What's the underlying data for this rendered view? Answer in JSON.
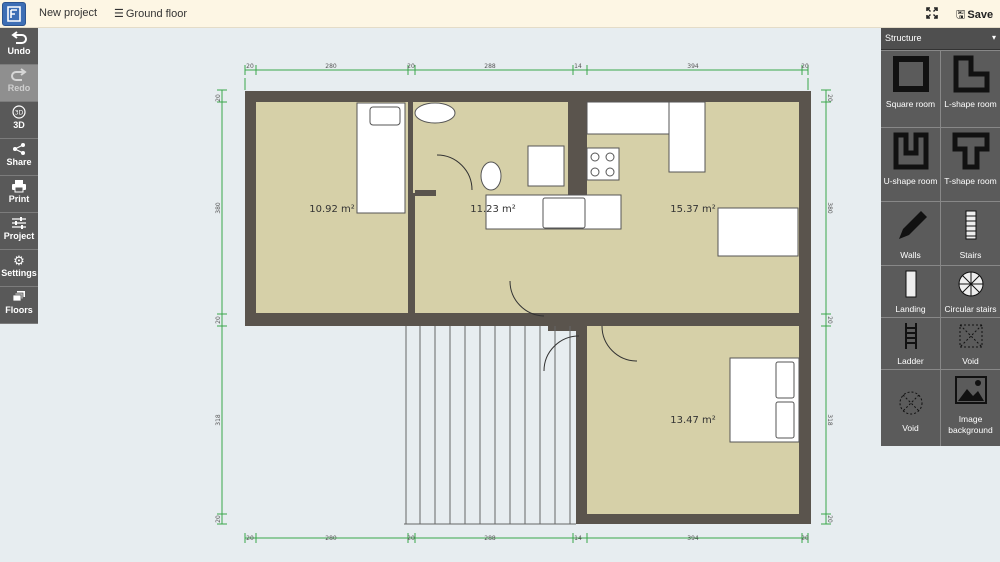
{
  "topbar": {
    "project_name": "New project",
    "floor_label": "Ground floor",
    "save_label": "Save"
  },
  "left_toolbar": [
    {
      "id": "undo",
      "label": "Undo",
      "icon": "undo-icon",
      "enabled": true
    },
    {
      "id": "redo",
      "label": "Redo",
      "icon": "redo-icon",
      "enabled": false
    },
    {
      "id": "3d",
      "label": "3D",
      "icon": "3d-icon",
      "enabled": true
    },
    {
      "id": "share",
      "label": "Share",
      "icon": "share-icon",
      "enabled": true
    },
    {
      "id": "print",
      "label": "Print",
      "icon": "print-icon",
      "enabled": true
    },
    {
      "id": "project",
      "label": "Project",
      "icon": "sliders-icon",
      "enabled": true
    },
    {
      "id": "settings",
      "label": "Settings",
      "icon": "gear-icon",
      "enabled": true
    },
    {
      "id": "floors",
      "label": "Floors",
      "icon": "floors-icon",
      "enabled": true
    }
  ],
  "right_panel": {
    "category": "Structure",
    "items": [
      {
        "label": "Square room",
        "icon": "square-room-icon"
      },
      {
        "label": "L-shape room",
        "icon": "l-shape-room-icon"
      },
      {
        "label": "U-shape room",
        "icon": "u-shape-room-icon"
      },
      {
        "label": "T-shape room",
        "icon": "t-shape-room-icon"
      },
      {
        "label": "Walls",
        "icon": "pencil-icon"
      },
      {
        "label": "Stairs",
        "icon": "stairs-icon"
      },
      {
        "label": "Landing",
        "icon": "landing-icon"
      },
      {
        "label": "Circular stairs",
        "icon": "circular-stairs-icon"
      },
      {
        "label": "Ladder",
        "icon": "ladder-icon"
      },
      {
        "label": "Void",
        "icon": "void-icon"
      },
      {
        "label": "Void",
        "icon": "void-circle-icon"
      },
      {
        "label": "Image background",
        "icon": "image-icon"
      }
    ]
  },
  "floorplan": {
    "rooms": [
      {
        "name": "room-bedroom-left",
        "area": "10.92 m²"
      },
      {
        "name": "room-hall",
        "area": "11.23 m²"
      },
      {
        "name": "room-kitchen",
        "area": "15.37 m²"
      },
      {
        "name": "room-bedroom-right",
        "area": "13.47 m²"
      }
    ],
    "dimensions_top": [
      "20",
      "280",
      "20",
      "288",
      "14",
      "394",
      "20"
    ],
    "dimensions_bottom": [
      "20",
      "280",
      "20",
      "288",
      "14",
      "394",
      "20"
    ],
    "dimensions_left": [
      "20",
      "380",
      "20",
      "318",
      "20"
    ],
    "dimensions_right": [
      "20",
      "380",
      "20",
      "318",
      "20"
    ]
  },
  "colors": {
    "wall": "#5a544d",
    "floor": "#d6d0a8",
    "dimension": "#3aa64a",
    "panel": "#5b5b5b"
  }
}
